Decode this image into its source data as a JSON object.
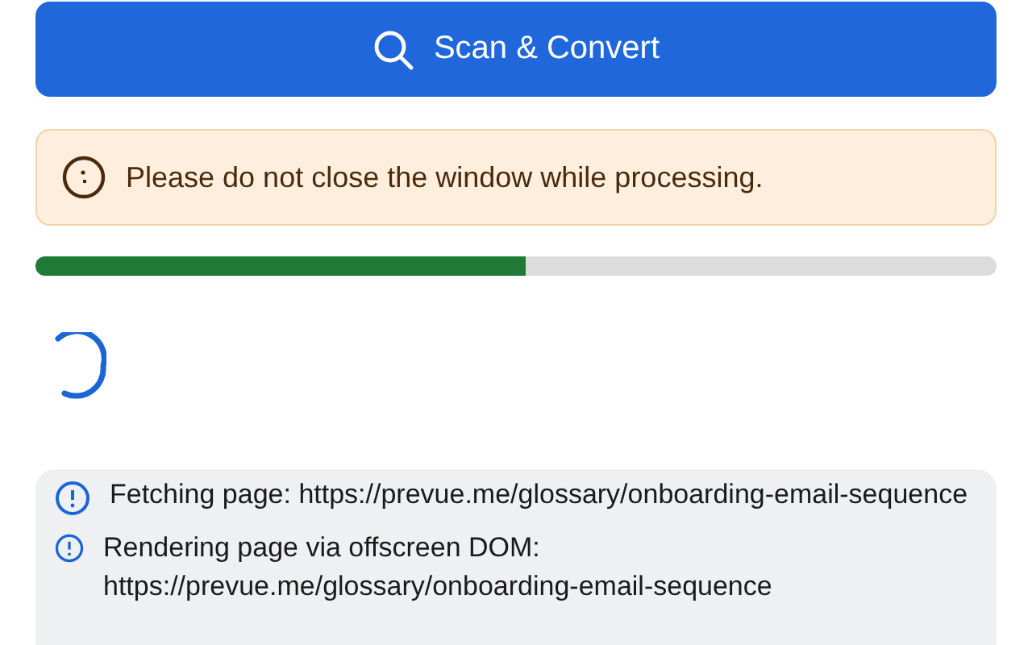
{
  "scan_button": {
    "label": "Scan & Convert"
  },
  "warning": {
    "text": "Please do not close the window while processing."
  },
  "progress": {
    "level": 0.51
  },
  "log": [
    {
      "text": "Fetching page: https://prevue.me/glossary/onboarding-email-sequence"
    },
    {
      "text": "Rendering page via offscreen DOM: https://prevue.me/glossary/onboarding-email-sequence"
    }
  ]
}
